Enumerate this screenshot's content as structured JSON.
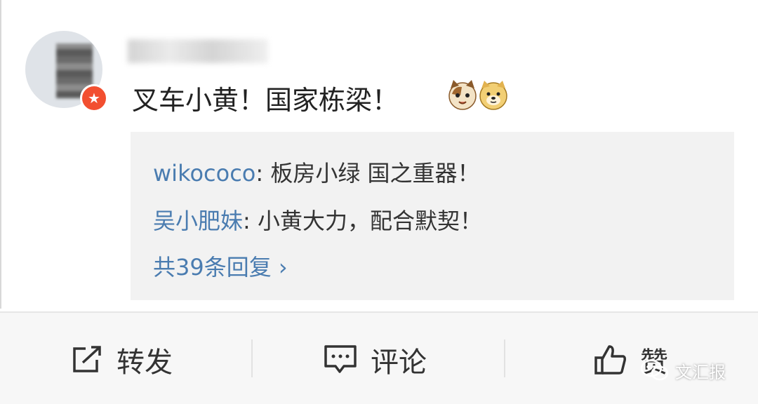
{
  "comment": {
    "text": "叉车小黄！国家栋梁！"
  },
  "replies": [
    {
      "author": "wikococo",
      "text": ": 板房小绿 国之重器！"
    },
    {
      "author": "吴小肥妹",
      "text": ": 小黄大力，配合默契！"
    }
  ],
  "more_replies": "共39条回复 ›",
  "actions": {
    "repost": "转发",
    "comment": "评论",
    "like": "赞"
  },
  "watermark": "文汇报",
  "colors": {
    "link_blue": "#4a7cb0",
    "badge_red": "#f24f30",
    "reply_bg": "#f2f2f2"
  },
  "icons": [
    "cat-emoji-icon",
    "doge-emoji-icon",
    "share-icon",
    "comment-icon",
    "thumbs-up-icon",
    "wechat-icon"
  ]
}
